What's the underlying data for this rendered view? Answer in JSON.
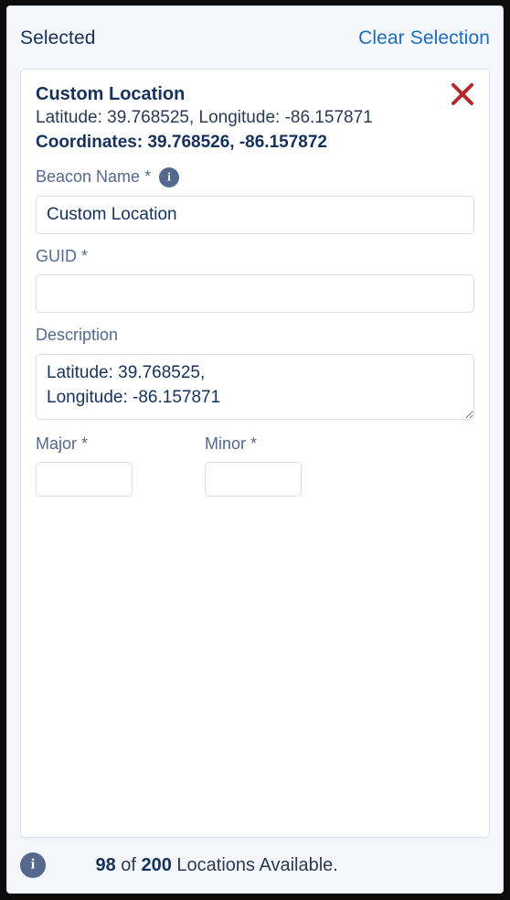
{
  "header": {
    "title": "Selected",
    "clear_label": "Clear Selection"
  },
  "colors": {
    "link": "#1b6ec2",
    "title_text": "#16325c",
    "label_text": "#54698d",
    "panel_bg": "#f4f6f9",
    "card_bg": "#ffffff",
    "border": "#d8dde6",
    "close_icon": "#b32a2a",
    "info_badge": "#54698d"
  },
  "record": {
    "name": "Custom Location",
    "latlong_line": "Latitude: 39.768525, Longitude: -86.157871",
    "coordinates_label": "Coordinates:",
    "coordinates_value": "39.768526, -86.157872",
    "close_icon": "close-x-icon"
  },
  "form": {
    "beacon_name": {
      "label": "Beacon Name",
      "required_mark": "*",
      "info_icon": "info-icon",
      "info_glyph": "i",
      "value": "Custom Location",
      "placeholder": ""
    },
    "guid": {
      "label": "GUID",
      "required_mark": "*",
      "value": "",
      "placeholder": ""
    },
    "description": {
      "label": "Description",
      "required_mark": "",
      "value": "Latitude: 39.768525,\nLongitude: -86.157871",
      "placeholder": ""
    },
    "major": {
      "label": "Major",
      "required_mark": "*",
      "value": "",
      "placeholder": ""
    },
    "minor": {
      "label": "Minor",
      "required_mark": "*",
      "value": "",
      "placeholder": ""
    }
  },
  "footer": {
    "info_icon": "info-icon",
    "info_glyph": "i",
    "available_count": "98",
    "of_word": " of ",
    "total_count": "200",
    "suffix": " Locations Available."
  }
}
